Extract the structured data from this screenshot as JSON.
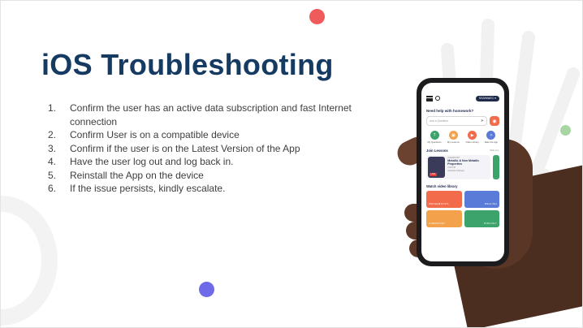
{
  "slide": {
    "title": "iOS Troubleshooting",
    "steps": [
      {
        "num": "1.",
        "text": "Confirm the user has an active data subscription and fast Internet connection"
      },
      {
        "num": "2.",
        "text": "Confirm User is on a compatible device"
      },
      {
        "num": "3.",
        "text": "Confirm if the user is on the Latest Version of the App"
      },
      {
        "num": "4.",
        "text": "Have the user log out and log back in."
      },
      {
        "num": "5.",
        "text": "Reinstall the App on the device"
      },
      {
        "num": "6.",
        "text": "If the issue persists, kindly escalate."
      }
    ]
  },
  "phone": {
    "grade_chip": "SS3/WAEC ▾",
    "help_heading": "Need help with homework?",
    "question_placeholder": "Ask a Question",
    "quick_actions": [
      "My Questions",
      "My Lessons",
      "Video Library",
      "Rate the App"
    ],
    "lessons_heading": "Join Lessons",
    "see_all": "SEE ALL",
    "lesson": {
      "subject": "CHEMISTRY",
      "title": "Metallic & Non Metallic Properties",
      "time": "3:00 PM",
      "teacher": "Adewale Adebayo",
      "live": "LIVE"
    },
    "video_heading": "Watch video library",
    "video_tiles": [
      "MATHEMATICS",
      "ENGLISH",
      "CHEMISTRY",
      "BIOLOGY"
    ]
  },
  "colors": {
    "title": "#163b63",
    "accent_red": "#ef5a5a",
    "accent_green": "#a8d5a2",
    "accent_purple": "#6e6ae8",
    "tile_math": "#f26b4a",
    "tile_english": "#5a7bd8",
    "tile_chem": "#f3a14a",
    "tile_bio": "#3ca36b"
  }
}
